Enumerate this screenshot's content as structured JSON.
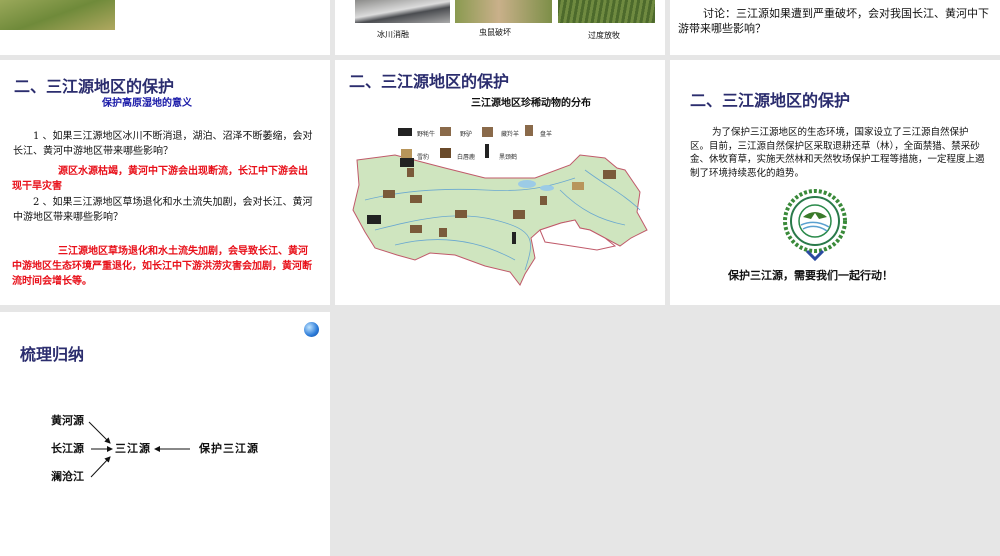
{
  "slides": [
    {
      "captions": []
    },
    {
      "captions": [
        "冰川消融",
        "虫鼠破坏",
        "过度放牧"
      ]
    },
    {
      "discussion": "讨论：三江源如果遭到严重破坏，会对我国长江、黄河中下游带来哪些影响？"
    },
    {
      "title": "二、三江源地区的保护",
      "subtitle": "保护高原湿地的意义",
      "q1": "1 、如果三江源地区冰川不断消退，湖泊、沼泽不断萎缩，会对长江、黄河中游地区带来哪些影响？",
      "a1": "源区水源枯竭，黄河中下游会出现断流，长江中下游会出现干旱灾害",
      "q2": "2 、如果三江源地区草场退化和水土流失加剧，会对长江、黄河中游地区带来哪些影响？",
      "a2": "三江源地区草场退化和水土流失加剧，会导致长江、黄河中游地区生态环境严重退化，如长江中下游洪涝灾害会加剧，黄河断流时间会增长等。"
    },
    {
      "title": "二、三江源地区的保护",
      "map_title": "三江源地区珍稀动物的分布",
      "legend": [
        "野牦牛",
        "野驴",
        "藏羚羊",
        "盘羊",
        "雪豹",
        "白唇鹿",
        "黑颈鹤"
      ]
    },
    {
      "title": "二、三江源地区的保护",
      "body": "为了保护三江源地区的生态环境，国家设立了三江源自然保护区。目前，三江源自然保护区采取退耕还草（林），全面禁猎、禁采砂金、休牧育草，实施天然林和天然牧场保护工程等措施，一定程度上遏制了环境持续恶化的趋势。",
      "slogan": "保护三江源，需要我们一起行动！"
    },
    {
      "title": "梳理归纳",
      "sources": [
        "黄河源",
        "长江源",
        "澜沧江"
      ],
      "center": "三江源",
      "right": "保护三江源"
    }
  ],
  "colors": {
    "title": "#2b2d6e",
    "answer": "#e8101a",
    "subtitle": "#1a1aa8",
    "map": "#cfe5bf"
  }
}
